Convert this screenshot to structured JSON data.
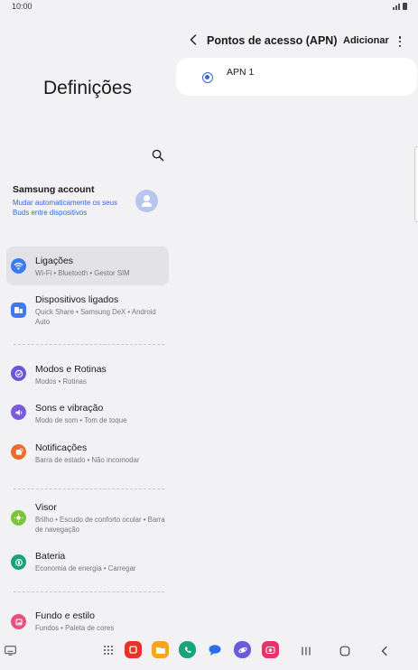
{
  "status_bar": {
    "time": "10:00"
  },
  "settings": {
    "title": "Definições",
    "account": {
      "name": "Samsung account",
      "subtitle": "Mudar automaticamente os seus Buds entre dispositivos"
    },
    "items": [
      {
        "title": "Ligações",
        "subtitle": "Wi-Fi  •  Bluetooth  •  Gestor SIM",
        "icon": "wifi-icon",
        "color": "#3a7cf0"
      },
      {
        "title": "Dispositivos ligados",
        "subtitle": "Quick Share  •  Samsung DeX  •  Android Auto",
        "icon": "devices-icon",
        "color": "#3a7cf0"
      },
      {
        "title": "Modos e Rotinas",
        "subtitle": "Modos  •  Rotinas",
        "icon": "check-circle-icon",
        "color": "#6a58d8"
      },
      {
        "title": "Sons e vibração",
        "subtitle": "Modo de som  •  Tom de toque",
        "icon": "speaker-icon",
        "color": "#7a5bdc"
      },
      {
        "title": "Notificações",
        "subtitle": "Barra de estado  •  Não incomodar",
        "icon": "bell-icon",
        "color": "#f06a2a"
      },
      {
        "title": "Visor",
        "subtitle": "Brilho  •  Escudo de conforto ocular  •  Barra de navegação",
        "icon": "sun-icon",
        "color": "#7cc43c"
      },
      {
        "title": "Bateria",
        "subtitle": "Economia de energia  •  Carregar",
        "icon": "battery-icon",
        "color": "#1aa37a"
      },
      {
        "title": "Fundo e estilo",
        "subtitle": "Fundos  •  Paleta de cores",
        "icon": "palette-icon",
        "color": "#e8517f"
      }
    ]
  },
  "apn": {
    "title": "Pontos de acesso (APN)",
    "add_label": "Adicionar",
    "entries": [
      {
        "name": "APN 1",
        "selected": true
      }
    ]
  },
  "nav": {
    "apps": [
      {
        "name": "samsung-notes-icon",
        "color": "#e5332a"
      },
      {
        "name": "my-files-icon",
        "color": "#f4a623"
      },
      {
        "name": "phone-icon",
        "color": "#1aa37a"
      },
      {
        "name": "messages-icon",
        "color": "#2a6ee8"
      },
      {
        "name": "internet-icon",
        "color": "#6a5bdc"
      },
      {
        "name": "camera-icon",
        "color": "#e8336a"
      }
    ]
  }
}
